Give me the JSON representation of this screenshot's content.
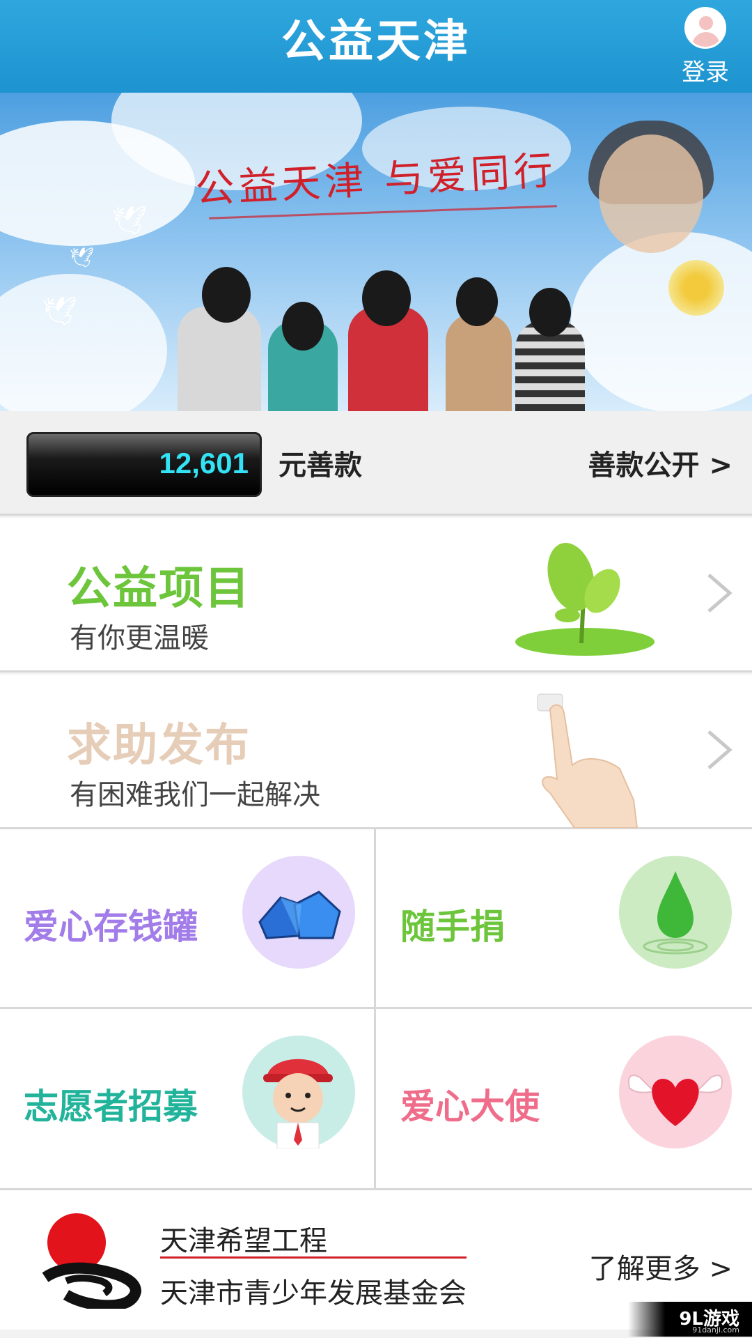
{
  "header": {
    "title": "公益天津",
    "login_label": "登录"
  },
  "banner": {
    "slogan": "公益天津  与爱同行"
  },
  "donation": {
    "amount": "12,601",
    "unit": "元善款",
    "public_link": "善款公开 >"
  },
  "rows": [
    {
      "title": "公益项目",
      "subtitle": "有你更温暖",
      "title_color": "#6cc53a"
    },
    {
      "title": "求助发布",
      "subtitle": "有困难我们一起解决",
      "title_color": "#e6cdb8"
    }
  ],
  "grid": [
    {
      "label": "爱心存钱罐",
      "color": "#a27ce8",
      "icon": "piggy-bank-gems-icon",
      "icon_bg": "#e6d9fb"
    },
    {
      "label": "随手捐",
      "color": "#6cc53a",
      "icon": "water-drop-icon",
      "icon_bg": "#cdebc2"
    },
    {
      "label": "志愿者招募",
      "color": "#22b39b",
      "icon": "volunteer-cartoon-icon",
      "icon_bg": "#c8ede6"
    },
    {
      "label": "爱心大使",
      "color": "#ef6d8a",
      "icon": "winged-heart-icon",
      "icon_bg": "#fbd3dc"
    }
  ],
  "footer": {
    "org_name_1": "天津希望工程",
    "org_name_2": "天津市青少年发展基金会",
    "more_link": "了解更多 >",
    "watermark": "9L游戏",
    "watermark_sub": "91danji.com"
  }
}
